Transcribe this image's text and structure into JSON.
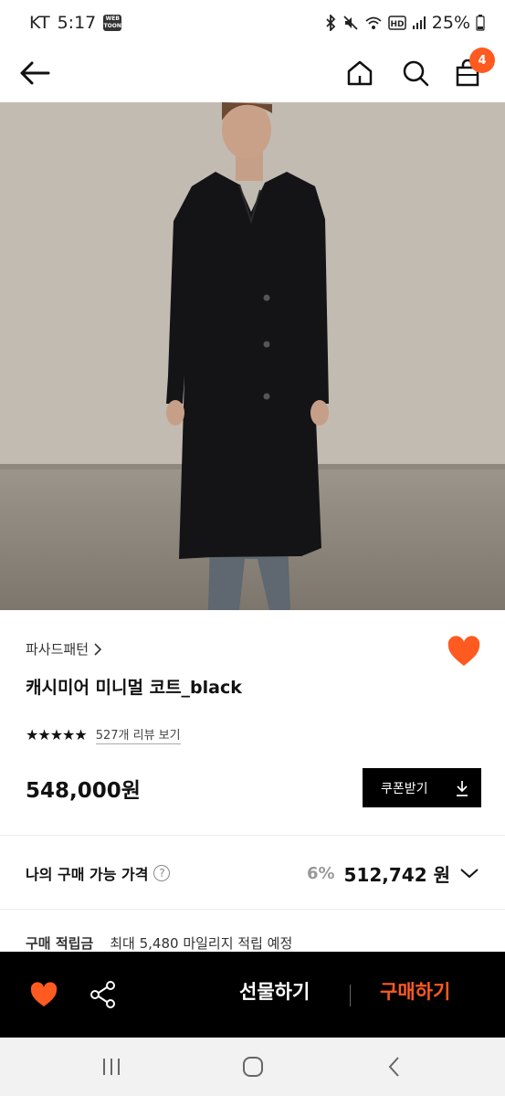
{
  "status_bar": {
    "carrier": "KT",
    "time": "5:17",
    "app_badge": "WEB TOON",
    "battery": "25%"
  },
  "header": {
    "cart_count": "4"
  },
  "product": {
    "brand": "파사드패턴",
    "name": "캐시미어 미니멀 코트_black",
    "stars": "★★★★★",
    "review_link": "527개 리뷰 보기",
    "price": "548,000원",
    "coupon_label": "쿠폰받기"
  },
  "my_price": {
    "label": "나의 구매 가능 가격",
    "discount": "6%",
    "price": "512,742 원"
  },
  "points": {
    "label": "구매 적립금",
    "text": "최대 5,480 마일리지 적립 예정"
  },
  "bottom_bar": {
    "gift_label": "선물하기",
    "buy_label": "구매하기"
  },
  "colors": {
    "accent": "#ff5a1f",
    "wish": "#ff5a1f"
  }
}
